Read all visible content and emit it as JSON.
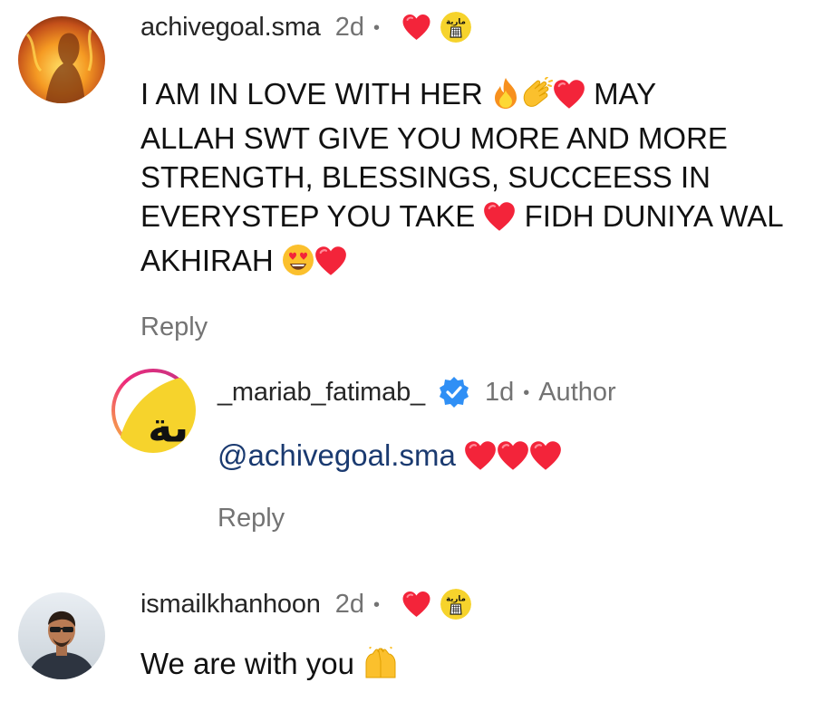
{
  "comments": [
    {
      "username": "achivegoal.sma",
      "time": "2d",
      "text_parts": [
        "I AM IN LOVE WITH HER",
        "MAY",
        "ALLAH SWT GIVE YOU MORE AND MORE",
        "STRENGTH, BLESSINGS, SUCCEESS IN",
        "EVERYSTEP YOU TAKE",
        "FIDH DUNIYA WAL",
        "AKHIRAH"
      ],
      "reply_label": "Reply",
      "liked_by_author": true
    },
    {
      "username": "_mariab_fatimab_",
      "time": "1d",
      "author_label": "Author",
      "mention": "@achivegoal.sma",
      "reply_label": "Reply",
      "verified": true
    },
    {
      "username": "ismailkhanhoon",
      "time": "2d",
      "text": "We are with you",
      "liked_by_author": true
    }
  ],
  "separator": "•",
  "colors": {
    "heart": "#f3243a",
    "verified": "#2f8ff5",
    "mention": "#1a3a70",
    "muted": "#737373",
    "avatar_ring_start": "#f9c93a",
    "avatar_ring_end": "#c13584"
  },
  "icons": {
    "heart": "heart-icon",
    "verified": "verified-badge-icon",
    "fire": "fire-emoji",
    "clap": "clapping-hands-emoji",
    "heart_eyes": "heart-eyes-emoji",
    "raised_hands": "raised-hands-emoji"
  }
}
